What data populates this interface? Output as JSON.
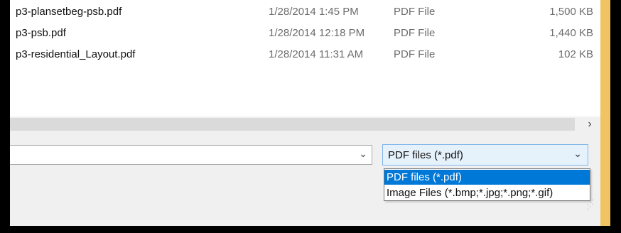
{
  "files": [
    {
      "name": "p3-plansetbeg-psb.pdf",
      "date": "1/28/2014 1:45 PM",
      "type": "PDF File",
      "size": "1,500 KB"
    },
    {
      "name": "p3-psb.pdf",
      "date": "1/28/2014 12:18 PM",
      "type": "PDF File",
      "size": "1,440 KB"
    },
    {
      "name": "p3-residential_Layout.pdf",
      "date": "1/28/2014 11:31 AM",
      "type": "PDF File",
      "size": "102 KB"
    }
  ],
  "hscroll": {
    "right_arrow": "›"
  },
  "filename": {
    "value": "",
    "chevron": "⌄"
  },
  "filetype": {
    "selected": "PDF files (*.pdf)",
    "chevron": "⌄",
    "options": [
      "PDF files (*.pdf)",
      "Image Files (*.bmp;*.jpg;*.png;*.gif)"
    ]
  },
  "colors": {
    "selection": "#0078d7",
    "frame_accent": "#f0c463",
    "combo_highlight": "#e5f1fb"
  },
  "icons": {
    "resize_grip": "resize-grip-icon"
  }
}
